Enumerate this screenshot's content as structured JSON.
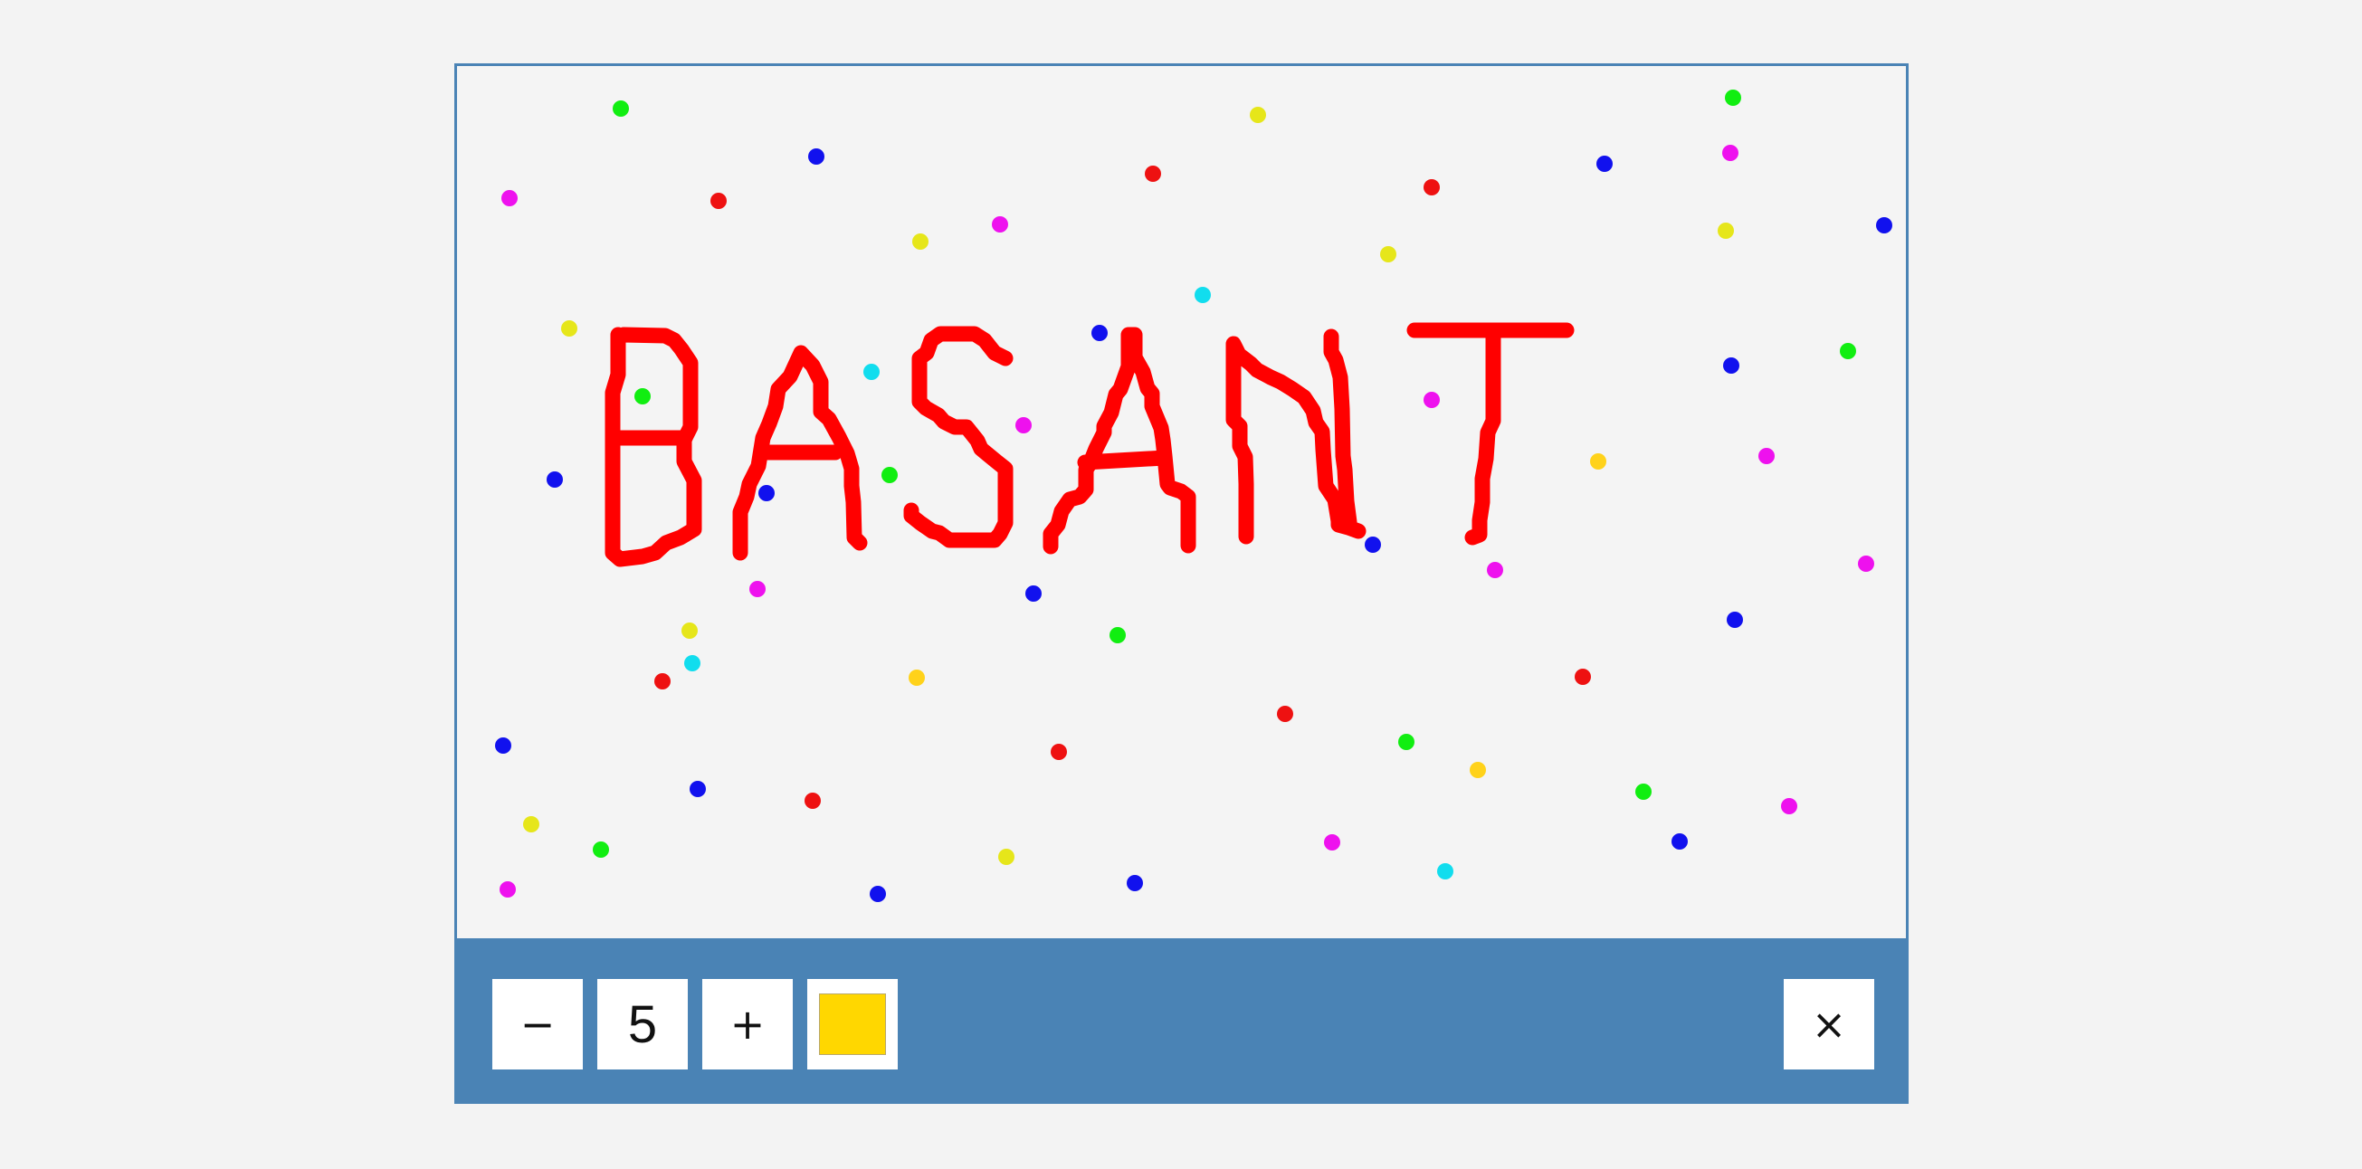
{
  "canvas": {
    "drawn_text": "BASANT",
    "stroke_color": "#ff0000",
    "dot_colors": {
      "red": "#ee1111",
      "green": "#11ee11",
      "blue": "#1111ee",
      "magenta": "#ee11ee",
      "yellow": "#e6e61a",
      "gold": "#ffd21a",
      "cyan": "#11ddee"
    }
  },
  "toolbar": {
    "decrease_label": "−",
    "size_value": "5",
    "increase_label": "+",
    "selected_color": "#ffd700",
    "close_label": "×",
    "background_color": "#4a83b5"
  }
}
